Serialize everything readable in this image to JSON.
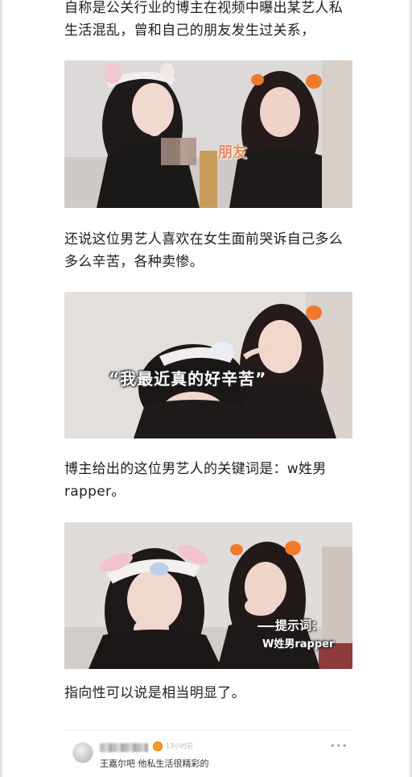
{
  "article": {
    "paragraph_1": "自称是公关行业的博主在视频中曝出某艺人私生活混乱，曾和自己的朋友发生过关系，",
    "image_1_caption": "朋友",
    "paragraph_2": "还说这位男艺人喜欢在女生面前哭诉自己多么多么辛苦，各种卖惨。",
    "image_2_caption": "“我最近真的好辛苦”",
    "paragraph_3": "博主给出的这位男艺人的关键词是：w姓男rapper。",
    "image_3_caption_title": "提示词：",
    "image_3_caption_body": "W姓男rapper",
    "paragraph_4": "指向性可以说是相当明显了。"
  },
  "comment": {
    "time": "13小时前",
    "text": "王嘉尔吧 他私生活很精彩的",
    "more_icon": "ellipsis-icon"
  },
  "colors": {
    "background": "#ffffff",
    "caption_orange": "#e58a57",
    "text": "#1d1d1d"
  }
}
